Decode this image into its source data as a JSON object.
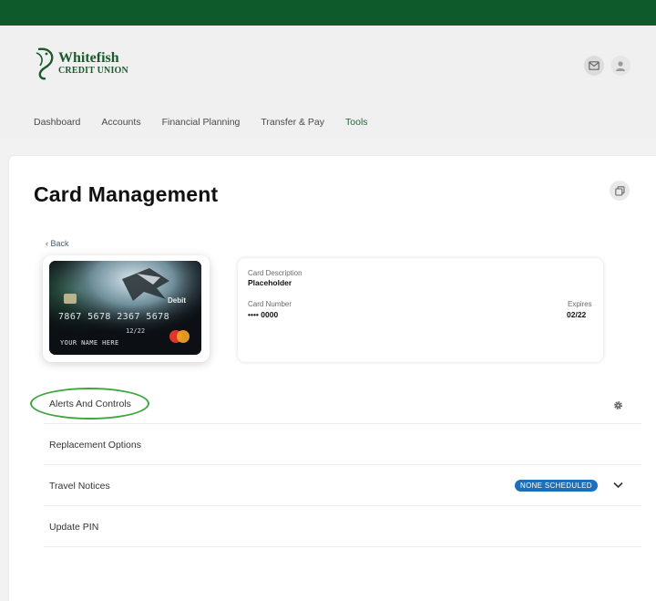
{
  "brand": {
    "name": "Whitefish",
    "sub": "CREDIT UNION",
    "colors": {
      "top_bar": "#0f5a2a",
      "logo": "#1b5a2f",
      "accent_nav": "#1c6b37",
      "badge": "#1d6fb8",
      "annotation": "#3fa540"
    }
  },
  "header": {
    "icons": [
      "mail-icon",
      "user-icon"
    ],
    "nav": [
      {
        "label": "Dashboard",
        "active": false
      },
      {
        "label": "Accounts",
        "active": false
      },
      {
        "label": "Financial Planning",
        "active": false
      },
      {
        "label": "Transfer & Pay",
        "active": false
      },
      {
        "label": "Tools",
        "active": true
      }
    ]
  },
  "page": {
    "title": "Card Management",
    "back": "Back"
  },
  "card_image": {
    "network_label": "Debit",
    "number": "7867 5678 2367 5678",
    "expiry": "12/22",
    "holder": "YOUR NAME HERE"
  },
  "card_info": {
    "description_label": "Card Description",
    "description_value": "Placeholder",
    "number_label": "Card Number",
    "number_value": "•••• 0000",
    "expires_label": "Expires",
    "expires_value": "02/22"
  },
  "options": [
    {
      "label": "Alerts And Controls",
      "icon": "gear-icon"
    },
    {
      "label": "Replacement Options"
    },
    {
      "label": "Travel Notices",
      "badge": "NONE SCHEDULED",
      "icon": "chevron-down-icon"
    },
    {
      "label": "Update PIN"
    }
  ]
}
